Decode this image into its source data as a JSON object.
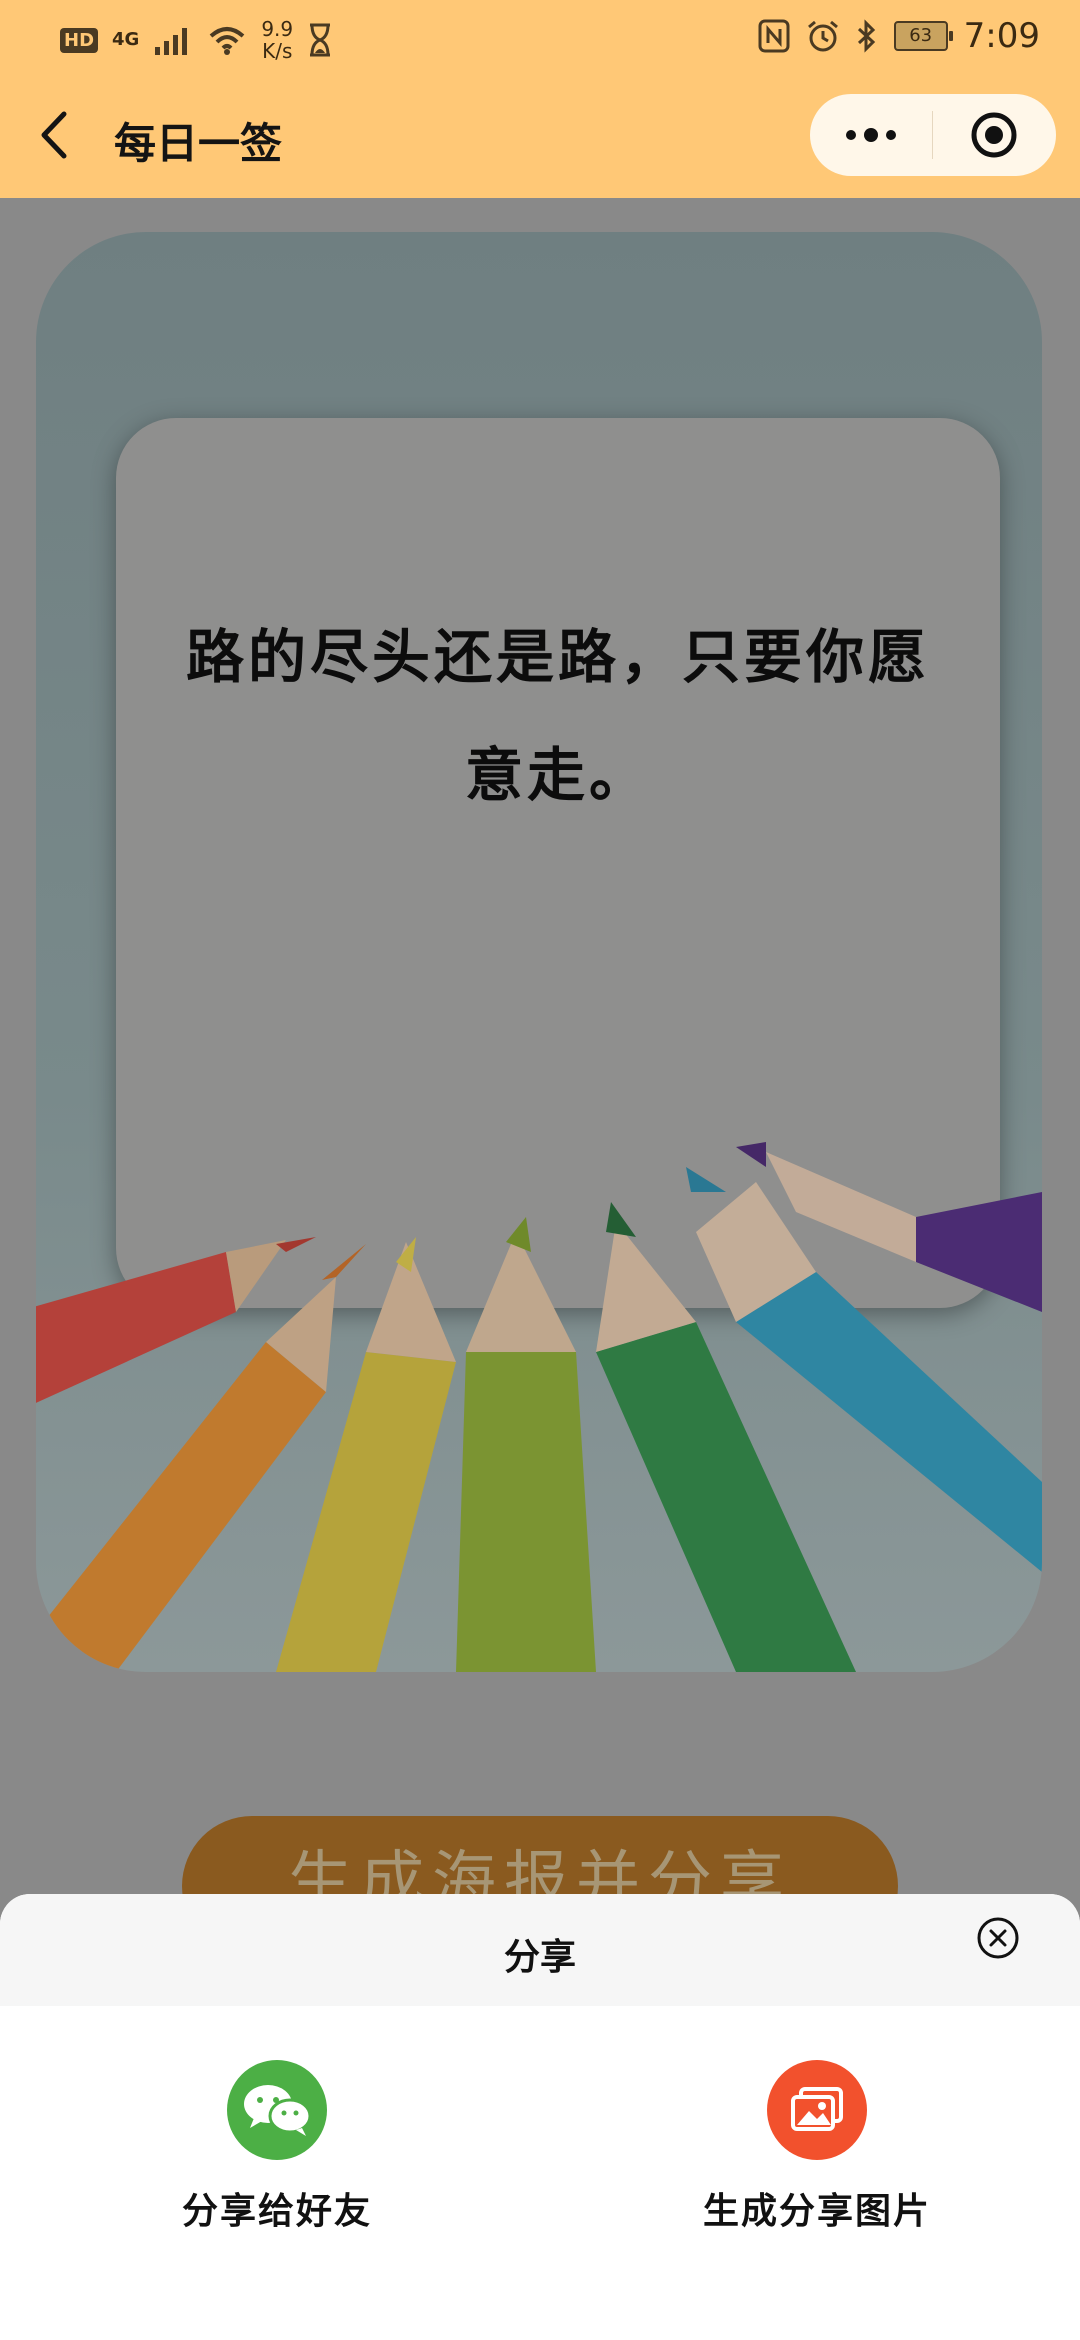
{
  "status_bar": {
    "hd": "HD",
    "network": "4G",
    "speed_value": "9.9",
    "speed_unit": "K/s",
    "battery": "63",
    "time": "7:09"
  },
  "nav": {
    "title": "每日一签"
  },
  "card": {
    "quote": "路的尽头还是路，只要你愿意走。"
  },
  "poster_button": {
    "label": "生成海报并分享"
  },
  "share_sheet": {
    "title": "分享",
    "options": [
      {
        "label": "分享给好友",
        "icon": "wechat-icon",
        "color": "#4caf45"
      },
      {
        "label": "生成分享图片",
        "icon": "image-icon",
        "color": "#f2512d"
      }
    ]
  },
  "colors": {
    "header_bg": "#ffc876",
    "overlay": "#898989",
    "sheet_header_bg": "#f6f6f6"
  }
}
